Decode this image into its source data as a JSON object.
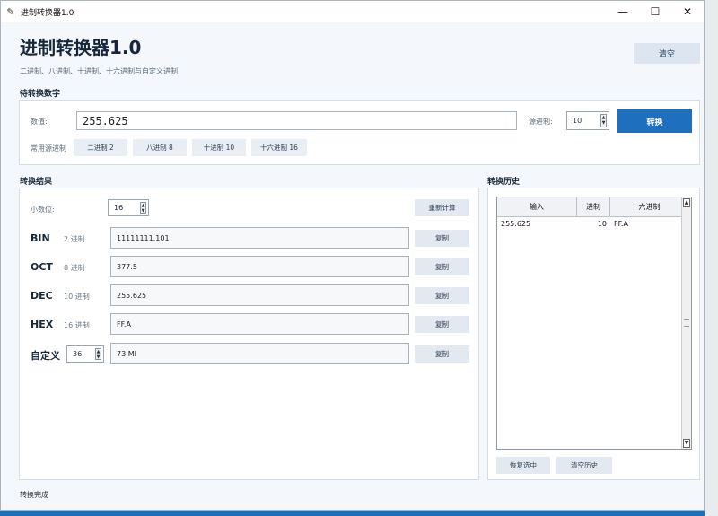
{
  "window": {
    "title": "进制转换器1.0",
    "minimize": "—",
    "maximize": "☐",
    "close": "✕"
  },
  "header": {
    "title": "进制转换器1.0",
    "subtitle": "二进制、八进制、十进制、十六进制与自定义进制",
    "clear_label": "清空"
  },
  "input_section": {
    "label": "待转换数字",
    "value_label": "数值:",
    "value": "255.625",
    "base_label": "源进制:",
    "base_value": "10",
    "convert_label": "转换",
    "common_label": "常用源进制",
    "presets": [
      "二进制 2",
      "八进制 8",
      "十进制 10",
      "十六进制 16"
    ]
  },
  "result_section": {
    "label": "转换结果",
    "decimals_label": "小数位:",
    "decimals_value": "16",
    "recalc_label": "重新计算",
    "copy_label": "复制",
    "rows": [
      {
        "name": "BIN",
        "base": "2 进制",
        "value": "11111111.101"
      },
      {
        "name": "OCT",
        "base": "8 进制",
        "value": "377.5"
      },
      {
        "name": "DEC",
        "base": "10 进制",
        "value": "255.625"
      },
      {
        "name": "HEX",
        "base": "16 进制",
        "value": "FF.A"
      }
    ],
    "custom": {
      "name": "自定义",
      "base": "36",
      "value": "73.MI"
    }
  },
  "history_section": {
    "label": "转换历史",
    "columns": [
      "输入",
      "进制",
      "十六进制"
    ],
    "rows": [
      {
        "input": "255.625",
        "base": "10",
        "hex": "FF.A"
      }
    ],
    "restore_label": "恢复选中",
    "clear_label": "清空历史"
  },
  "status": "转换完成"
}
